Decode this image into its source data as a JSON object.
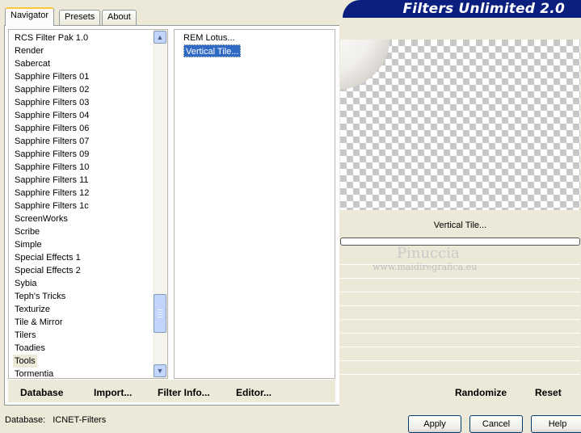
{
  "tabs": [
    "Navigator",
    "Presets",
    "About"
  ],
  "banner_title": "Filters Unlimited 2.0",
  "categories": [
    "RCS Filter Pak 1.0",
    "Render",
    "Sabercat",
    "Sapphire Filters 01",
    "Sapphire Filters 02",
    "Sapphire Filters 03",
    "Sapphire Filters 04",
    "Sapphire Filters 06",
    "Sapphire Filters 07",
    "Sapphire Filters 09",
    "Sapphire Filters 10",
    "Sapphire Filters 11",
    "Sapphire Filters 12",
    "Sapphire Filters 1c",
    "ScreenWorks",
    "Scribe",
    "Simple",
    "Special Effects 1",
    "Special Effects 2",
    "Sybia",
    "Teph's Tricks",
    "Texturize",
    "Tile & Mirror",
    "Tilers",
    "Toadies",
    "Tools",
    "Tormentia"
  ],
  "selected_category": "Tools",
  "filters": [
    "REM Lotus...",
    "Vertical Tile..."
  ],
  "selected_filter": "Vertical Tile...",
  "filter_name_label": "Vertical Tile...",
  "watermark": {
    "name": "Pinuccia",
    "site": "www.maidiregrafica.eu"
  },
  "buttons": {
    "database": "Database",
    "import": "Import...",
    "filter_info": "Filter Info...",
    "editor": "Editor...",
    "randomize": "Randomize",
    "reset": "Reset",
    "apply": "Apply",
    "cancel": "Cancel",
    "help": "Help"
  },
  "status": {
    "database_label": "Database:",
    "database_value": "ICNET-Filters"
  },
  "colors": {
    "banner": "#0a1f7e",
    "selection": "#316ac5",
    "background": "#ece9d8"
  }
}
